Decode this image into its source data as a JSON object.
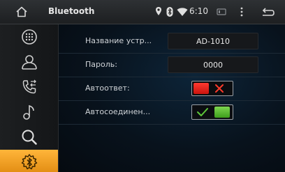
{
  "statusbar": {
    "title": "Bluetooth",
    "time": "6:10",
    "icons": [
      "home-icon",
      "location-icon",
      "bluetooth-icon",
      "wifi-icon",
      "sd-card-icon",
      "more-icon",
      "back-icon"
    ]
  },
  "sidebar": {
    "items": [
      {
        "icon": "dialpad-icon"
      },
      {
        "icon": "contacts-icon"
      },
      {
        "icon": "call-log-icon"
      },
      {
        "icon": "music-icon"
      },
      {
        "icon": "search-icon"
      },
      {
        "icon": "bluetooth-settings-icon",
        "active": true
      }
    ]
  },
  "settings": {
    "device_name_label": "Название устр...",
    "device_name_value": "AD-1010",
    "password_label": "Пароль:",
    "password_value": "0000",
    "auto_answer_label": "Автоответ:",
    "auto_answer_on": false,
    "auto_connect_label": "Автосоединен...",
    "auto_connect_on": true
  },
  "colors": {
    "accent": "#f5a020",
    "toggle_off": "#e0201c",
    "toggle_on": "#4caf2a"
  }
}
